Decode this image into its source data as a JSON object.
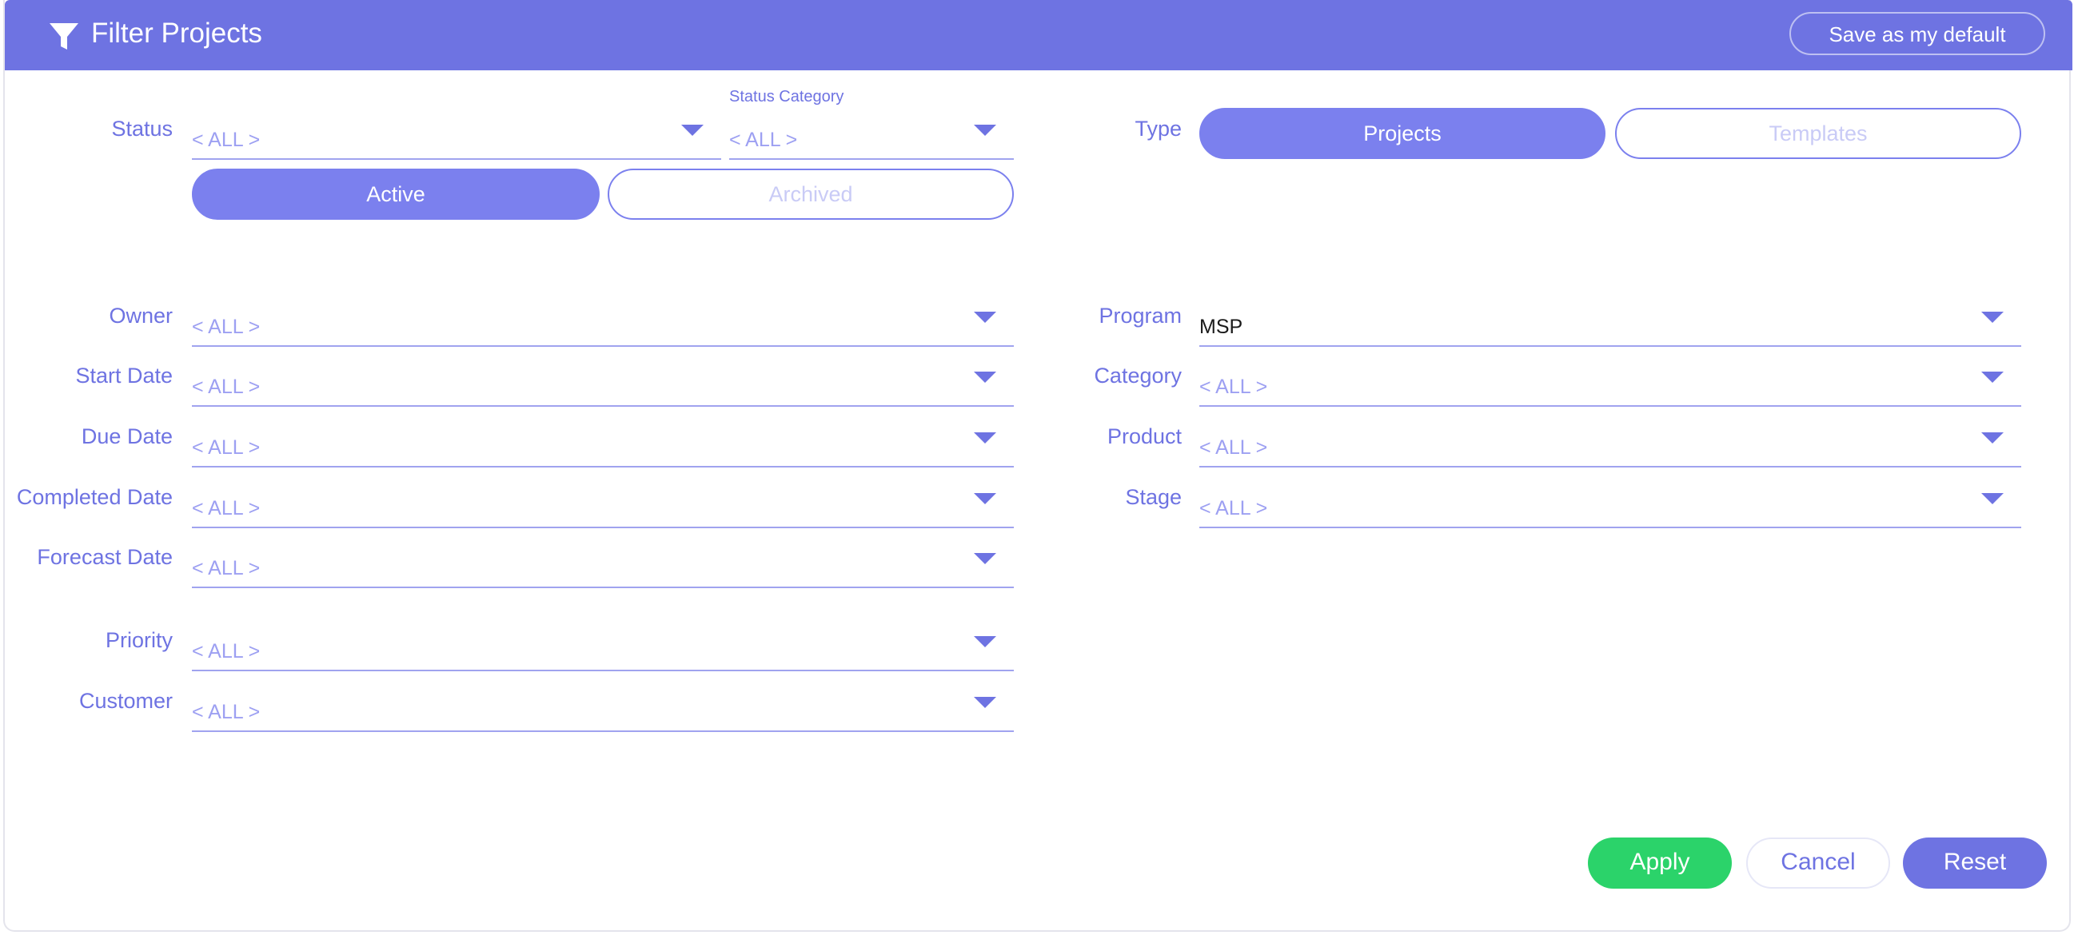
{
  "header": {
    "title": "Filter Projects",
    "save_default": "Save as my default"
  },
  "status": {
    "label": "Status",
    "value": "< ALL >",
    "category_label": "Status Category",
    "category_value": "< ALL >",
    "active": "Active",
    "archived": "Archived"
  },
  "type": {
    "label": "Type",
    "projects": "Projects",
    "templates": "Templates"
  },
  "left_fields": [
    {
      "label": "Owner",
      "value": "< ALL >"
    },
    {
      "label": "Start Date",
      "value": "< ALL >"
    },
    {
      "label": "Due Date",
      "value": "< ALL >"
    },
    {
      "label": "Completed Date",
      "value": "< ALL >"
    },
    {
      "label": "Forecast Date",
      "value": "< ALL >"
    },
    {
      "label": "Priority",
      "value": "< ALL >"
    },
    {
      "label": "Customer",
      "value": "< ALL >"
    }
  ],
  "right_fields": [
    {
      "label": "Program",
      "value": "MSP"
    },
    {
      "label": "Category",
      "value": "< ALL >"
    },
    {
      "label": "Product",
      "value": "< ALL >"
    },
    {
      "label": "Stage",
      "value": "< ALL >"
    }
  ],
  "footer": {
    "apply": "Apply",
    "cancel": "Cancel",
    "reset": "Reset"
  },
  "colors": {
    "accent": "#6e73e2",
    "apply": "#2bd36a",
    "underline": "#a0a3ef"
  },
  "icons": {
    "header": "filter-icon",
    "dropdown": "caret-down-icon"
  }
}
